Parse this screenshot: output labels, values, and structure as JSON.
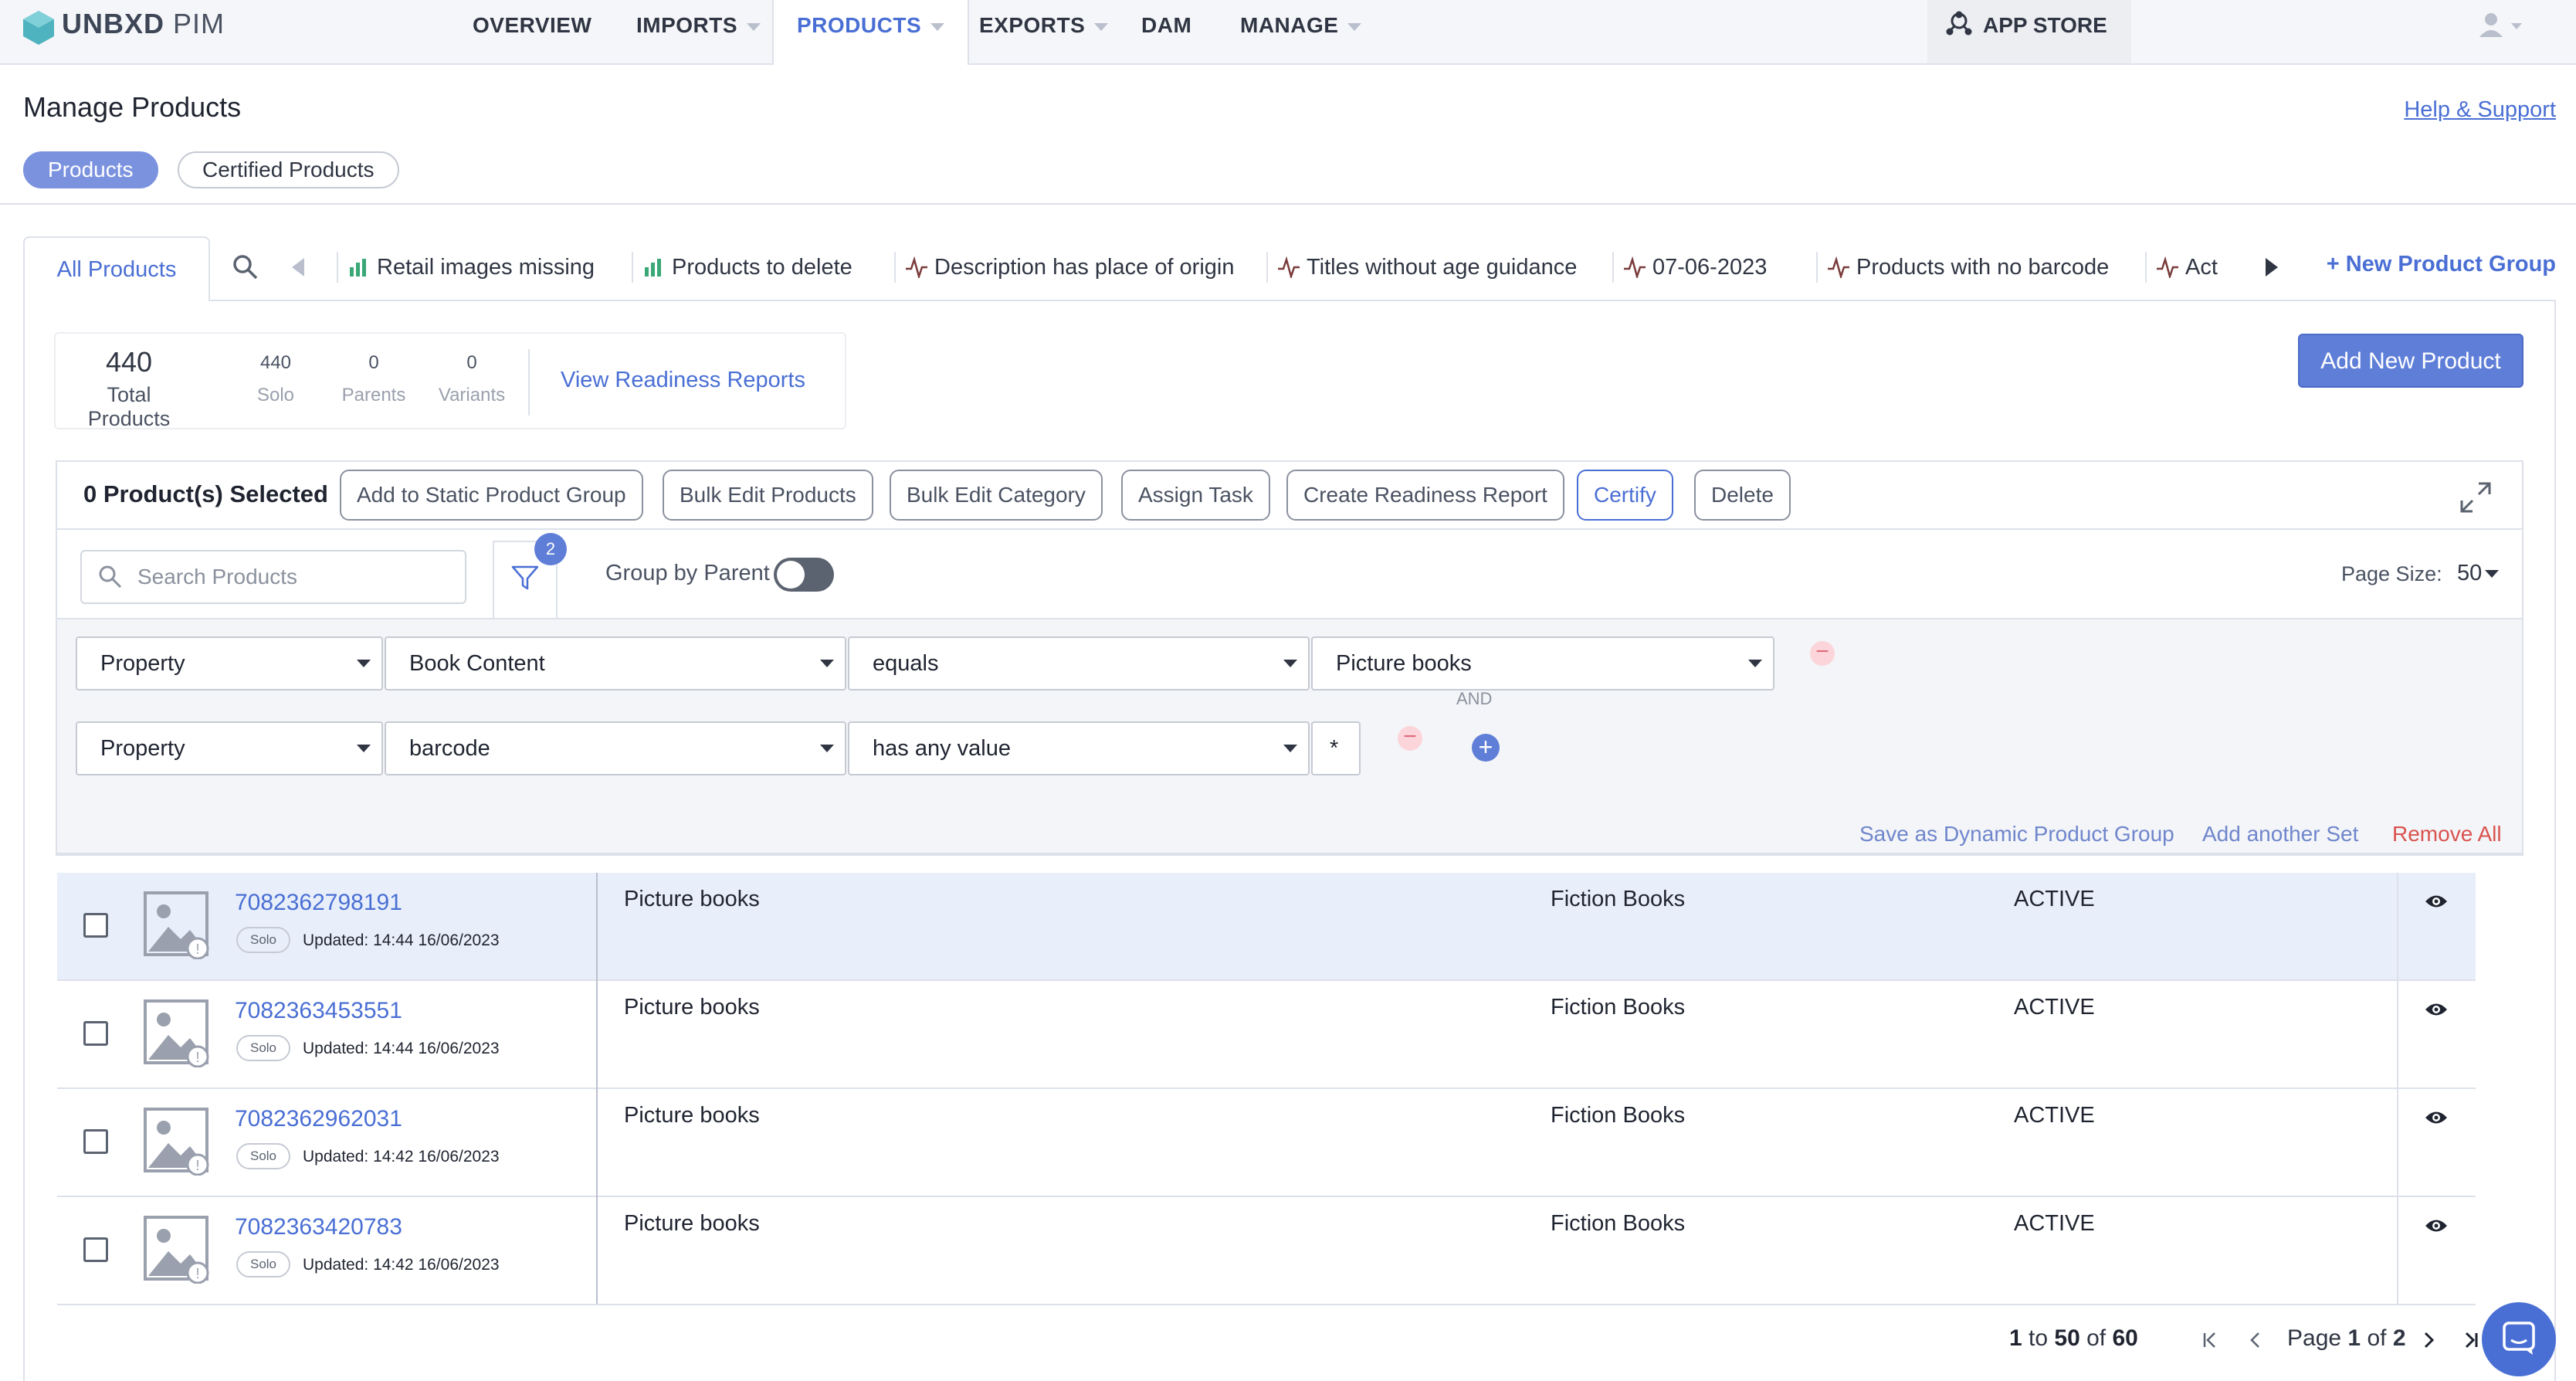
{
  "brand": {
    "name": "UNBXD",
    "suffix": "PIM"
  },
  "nav": {
    "overview": "OVERVIEW",
    "imports": "IMPORTS",
    "products": "PRODUCTS",
    "exports": "EXPORTS",
    "dam": "DAM",
    "manage": "MANAGE",
    "app_store": "APP STORE"
  },
  "header": {
    "title": "Manage Products",
    "help": "Help & Support",
    "pills": [
      "Products",
      "Certified Products"
    ]
  },
  "tabs": {
    "all": "All Products",
    "groups": [
      "Retail images missing",
      "Products to delete",
      "Description has place of origin",
      "Titles without age guidance",
      "07-06-2023",
      "Products with no barcode",
      "Act"
    ],
    "new_group": "+ New Product Group"
  },
  "stats": {
    "total": "440",
    "total_label": "Total Products",
    "solo": "440",
    "solo_label": "Solo",
    "parents": "0",
    "parents_label": "Parents",
    "variants": "0",
    "variants_label": "Variants",
    "reports_link": "View Readiness Reports"
  },
  "add_button": "Add New Product",
  "actions": {
    "selected": "0 Product(s) Selected",
    "buttons": [
      "Add to Static Product Group",
      "Bulk Edit Products",
      "Bulk Edit Category",
      "Assign Task",
      "Create Readiness Report",
      "Certify",
      "Delete"
    ]
  },
  "search": {
    "placeholder": "Search Products"
  },
  "filter_badge": "2",
  "group_by_parent": "Group by Parent",
  "page_size": {
    "label": "Page Size:",
    "value": "50"
  },
  "filters": [
    {
      "type": "Property",
      "field": "Book Content",
      "op": "equals",
      "value": "Picture books"
    },
    {
      "type": "Property",
      "field": "barcode",
      "op": "has any value",
      "value": "*"
    }
  ],
  "and_label": "AND",
  "filter_links": {
    "save": "Save as Dynamic Product Group",
    "add_set": "Add another Set",
    "remove_all": "Remove All"
  },
  "rows": [
    {
      "id": "7082362798191",
      "badge": "Solo",
      "updated": "Updated: 14:44 16/06/2023",
      "content": "Picture books",
      "category": "Fiction Books",
      "status": "ACTIVE"
    },
    {
      "id": "7082363453551",
      "badge": "Solo",
      "updated": "Updated: 14:44 16/06/2023",
      "content": "Picture books",
      "category": "Fiction Books",
      "status": "ACTIVE"
    },
    {
      "id": "7082362962031",
      "badge": "Solo",
      "updated": "Updated: 14:42 16/06/2023",
      "content": "Picture books",
      "category": "Fiction Books",
      "status": "ACTIVE"
    },
    {
      "id": "7082363420783",
      "badge": "Solo",
      "updated": "Updated: 14:42 16/06/2023",
      "content": "Picture books",
      "category": "Fiction Books",
      "status": "ACTIVE"
    }
  ],
  "pagination": {
    "from": "1",
    "to_word": "to",
    "to": "50",
    "of_word": "of",
    "total": "60",
    "page_word": "Page",
    "page": "1",
    "pages": "2"
  },
  "colors": {
    "accent": "#4a6fd4",
    "primary_button": "#5f7ed8",
    "highlight_row": "#e8effa",
    "danger": "#d9534f"
  }
}
